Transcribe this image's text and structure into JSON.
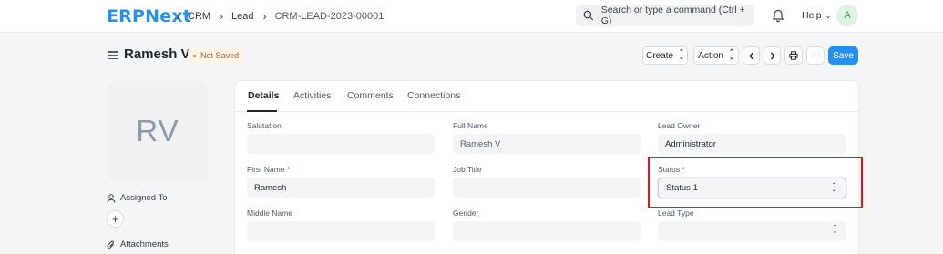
{
  "navbar": {
    "logo": "ERPNext",
    "breadcrumbs": [
      "CRM",
      "Lead",
      "CRM-LEAD-2023-00001"
    ],
    "search_placeholder": "Search or type a command (Ctrl + G)",
    "help_label": "Help",
    "user_initial": "A"
  },
  "page": {
    "title": "Ramesh V",
    "status_badge": "Not Saved",
    "buttons": {
      "create": "Create",
      "action": "Action",
      "more": "···",
      "save": "Save"
    }
  },
  "sidebar": {
    "avatar_initials": "RV",
    "assigned_to": "Assigned To",
    "attachments": "Attachments"
  },
  "tabs": [
    "Details",
    "Activities",
    "Comments",
    "Connections"
  ],
  "form": {
    "salutation": {
      "label": "Salutation",
      "value": ""
    },
    "full_name": {
      "label": "Full Name",
      "value": "Ramesh V"
    },
    "lead_owner": {
      "label": "Lead Owner",
      "value": "Administrator"
    },
    "first_name": {
      "label": "First Name",
      "required_mark": "*",
      "value": "Ramesh"
    },
    "job_title": {
      "label": "Job Title",
      "value": ""
    },
    "status": {
      "label": "Status",
      "required_mark": "*",
      "value": "Status 1"
    },
    "middle_name": {
      "label": "Middle Name",
      "value": ""
    },
    "gender": {
      "label": "Gender",
      "value": ""
    },
    "lead_type": {
      "label": "Lead Type",
      "value": ""
    }
  },
  "colors": {
    "accent": "#2490ef",
    "highlight": "#e6141c",
    "badge_text": "#b5603b"
  }
}
